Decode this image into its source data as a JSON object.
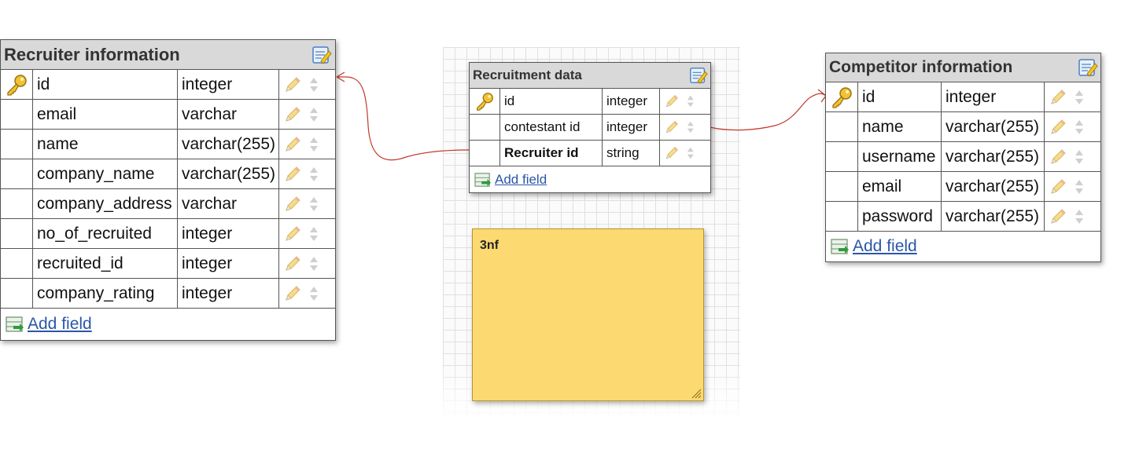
{
  "tables": [
    {
      "id": "recruiter",
      "title": "Recruiter information",
      "fields": [
        {
          "name": "id",
          "type": "integer",
          "primary_key": true
        },
        {
          "name": "email",
          "type": "varchar",
          "primary_key": false
        },
        {
          "name": "name",
          "type": "varchar(255)",
          "primary_key": false
        },
        {
          "name": "company_name",
          "type": "varchar(255)",
          "primary_key": false
        },
        {
          "name": "company_address",
          "type": "varchar",
          "primary_key": false
        },
        {
          "name": "no_of_recruited",
          "type": "integer",
          "primary_key": false
        },
        {
          "name": "recruited_id",
          "type": "integer",
          "primary_key": false
        },
        {
          "name": "company_rating",
          "type": "integer",
          "primary_key": false
        }
      ],
      "add_label": "Add field"
    },
    {
      "id": "recdata",
      "title": "Recruitment data",
      "fields": [
        {
          "name": "id",
          "type": "integer",
          "primary_key": true
        },
        {
          "name": "contestant id",
          "type": "integer",
          "primary_key": false
        },
        {
          "name": "Recruiter id",
          "type": "string",
          "primary_key": false
        }
      ],
      "add_label": "Add field"
    },
    {
      "id": "competitor",
      "title": "Competitor information",
      "fields": [
        {
          "name": "id",
          "type": "integer",
          "primary_key": true
        },
        {
          "name": "name",
          "type": "varchar(255)",
          "primary_key": false
        },
        {
          "name": "username",
          "type": "varchar(255)",
          "primary_key": false
        },
        {
          "name": "email",
          "type": "varchar(255)",
          "primary_key": false
        },
        {
          "name": "password",
          "type": "varchar(255)",
          "primary_key": false
        }
      ],
      "add_label": "Add field"
    }
  ],
  "note": {
    "text": "3nf"
  },
  "icons": {
    "primary_key": "key-icon",
    "edit_row": "pencil-icon",
    "reorder": "up-down-arrows-icon",
    "edit_table": "edit-table-icon",
    "add_field": "add-field-icon",
    "resize": "resize-grip-icon"
  },
  "colors": {
    "relation_line": "#c0392b",
    "note_background": "#fdd972",
    "table_header": "#d9d9d9",
    "link": "#2a56a8"
  }
}
